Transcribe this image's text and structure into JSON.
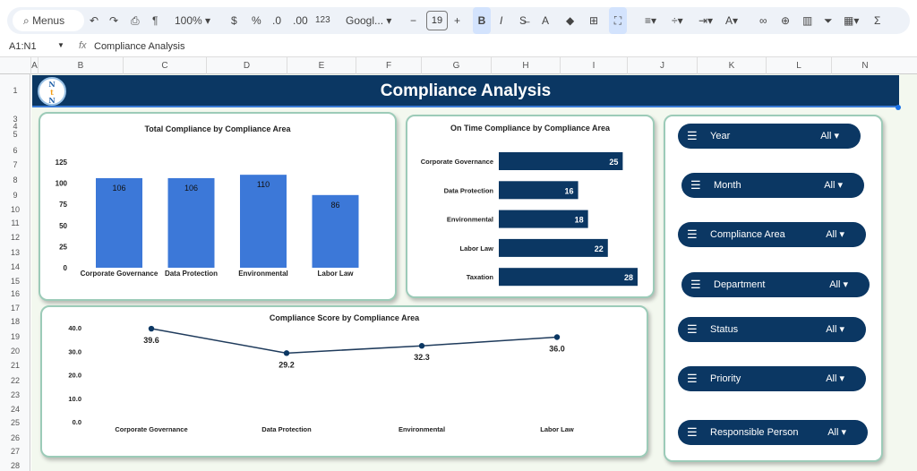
{
  "toolbar": {
    "menus": "Menus",
    "zoom": "100%",
    "currency": "$",
    "percent": "%",
    "dec_less": ".0",
    "dec_more": ".00",
    "format_123": "123",
    "font": "Googl...",
    "font_size": "19",
    "bold": "B",
    "italic": "I",
    "text_color": "A",
    "sum": "Σ"
  },
  "formula_bar": {
    "cell_ref": "A1:N1",
    "fx": "fx",
    "content": "Compliance Analysis"
  },
  "columns": [
    "A",
    "B",
    "C",
    "D",
    "E",
    "F",
    "G",
    "H",
    "I",
    "J",
    "K",
    "L",
    "N"
  ],
  "rows": [
    "1",
    "3",
    "4",
    "5",
    "6",
    "7",
    "8",
    "9",
    "10",
    "11",
    "12",
    "13",
    "14",
    "15",
    "16",
    "17",
    "18",
    "19",
    "20",
    "21",
    "22",
    "23",
    "24",
    "25",
    "26",
    "27",
    "28"
  ],
  "banner": {
    "title": "Compliance Analysis",
    "logo": "NtN"
  },
  "colors": {
    "banner": "#0b3763",
    "bar_blue": "#3c78d8",
    "bar_navy": "#0b3763",
    "sheet_bg": "#f3f8ef"
  },
  "chart_data": [
    {
      "type": "bar",
      "title": "Total Compliance by Compliance Area",
      "categories": [
        "Corporate Governance",
        "Data Protection",
        "Environmental",
        "Labor Law"
      ],
      "values": [
        106,
        106,
        110,
        86
      ],
      "yticks": [
        "0",
        "25",
        "50",
        "75",
        "100",
        "125"
      ],
      "ylim": [
        0,
        125
      ]
    },
    {
      "type": "bar",
      "orientation": "horizontal",
      "title": "On Time Compliance by Compliance Area",
      "categories": [
        "Corporate Governance",
        "Data Protection",
        "Environmental",
        "Labor Law",
        "Taxation"
      ],
      "values": [
        25,
        16,
        18,
        22,
        28
      ],
      "xlim": [
        0,
        28
      ]
    },
    {
      "type": "line",
      "title": "Compliance Score by Compliance Area",
      "categories": [
        "Corporate Governance",
        "Data Protection",
        "Environmental",
        "Labor Law"
      ],
      "values": [
        39.6,
        29.2,
        32.3,
        36.0
      ],
      "labels": [
        "39.6",
        "29.2",
        "32.3",
        "36.0"
      ],
      "yticks": [
        "0.0",
        "10.0",
        "20.0",
        "30.0",
        "40.0"
      ],
      "ylim": [
        0,
        40
      ]
    }
  ],
  "filters": [
    {
      "label": "Year",
      "value": "All"
    },
    {
      "label": "Month",
      "value": "All"
    },
    {
      "label": "Compliance Area",
      "value": "All"
    },
    {
      "label": "Department",
      "value": "All"
    },
    {
      "label": "Status",
      "value": "All"
    },
    {
      "label": "Priority",
      "value": "All"
    },
    {
      "label": "Responsible Person",
      "value": "All"
    }
  ]
}
